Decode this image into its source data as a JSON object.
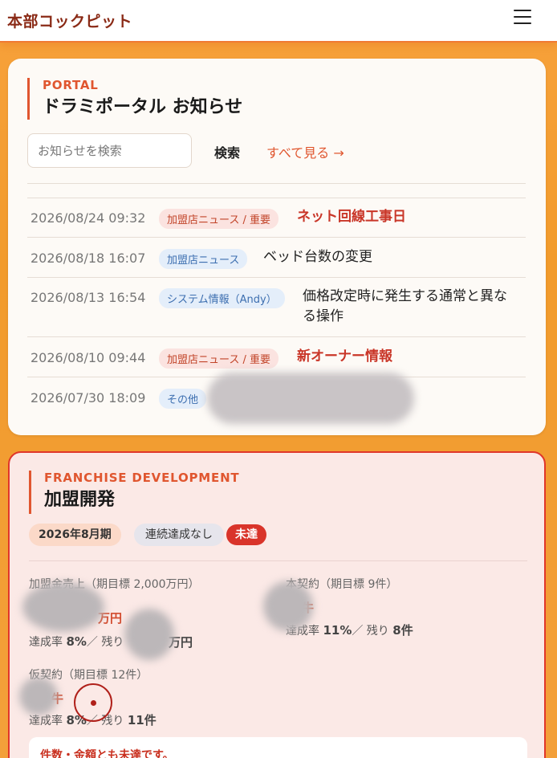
{
  "app": {
    "title": "本部コックピット",
    "menu_icon": "hamburger-menu-icon"
  },
  "portal": {
    "eyebrow": "PORTAL",
    "title": "ドラミポータル お知らせ",
    "search_placeholder": "お知らせを検索",
    "search_label": "検索",
    "see_all_label": "すべて見る →",
    "news": [
      {
        "date": "2026/08/24 09:32",
        "tag": "加盟店ニュース / 重要",
        "title": "ネット回線工事日",
        "important": true
      },
      {
        "date": "2026/08/18 16:07",
        "tag": "加盟店ニュース",
        "title": "ベッド台数の変更",
        "important": false
      },
      {
        "date": "2026/08/13 16:54",
        "tag": "システム情報（Andy）",
        "title_line1": "価格改定時に発生する通常と異な",
        "title_line2": "る操作",
        "important": false
      },
      {
        "date": "2026/08/10 09:44",
        "tag": "加盟店ニュース / 重要",
        "title": "新オーナー情報",
        "important": true
      },
      {
        "date": "2026/07/30 18:09",
        "tag": "その他",
        "title": "",
        "important": false
      }
    ]
  },
  "franchise": {
    "eyebrow": "FRANCHISE DEVELOPMENT",
    "title": "加盟開発",
    "period": "2026年8月期",
    "streak": "連続達成なし",
    "status": "未達",
    "metrics": {
      "sales": {
        "label": "加盟金売上（期目標 2,000万円）",
        "value_fragment": "万円",
        "rate_label": "達成率",
        "rate_value": "8%",
        "remain_label": "／ 残り",
        "remain_fragment": "万円"
      },
      "contract": {
        "label": "本契約（期目標 9件）",
        "value_fragment": "牛",
        "rate_label": "達成率",
        "rate_value": "11%",
        "remain_label": "／ 残り",
        "remain_value": "8件"
      },
      "provisional": {
        "label": "仮契約（期目標 12件）",
        "value_fragment": "牛",
        "rate_label": "達成率",
        "rate_value": "8%",
        "remain_label": "／ 残り",
        "remain_value": "11件"
      }
    },
    "notice": "件数・金額とも未達です。"
  },
  "colors": {
    "accent": "#e0562f",
    "danger": "#d9342a",
    "background": "#f29b2c"
  }
}
